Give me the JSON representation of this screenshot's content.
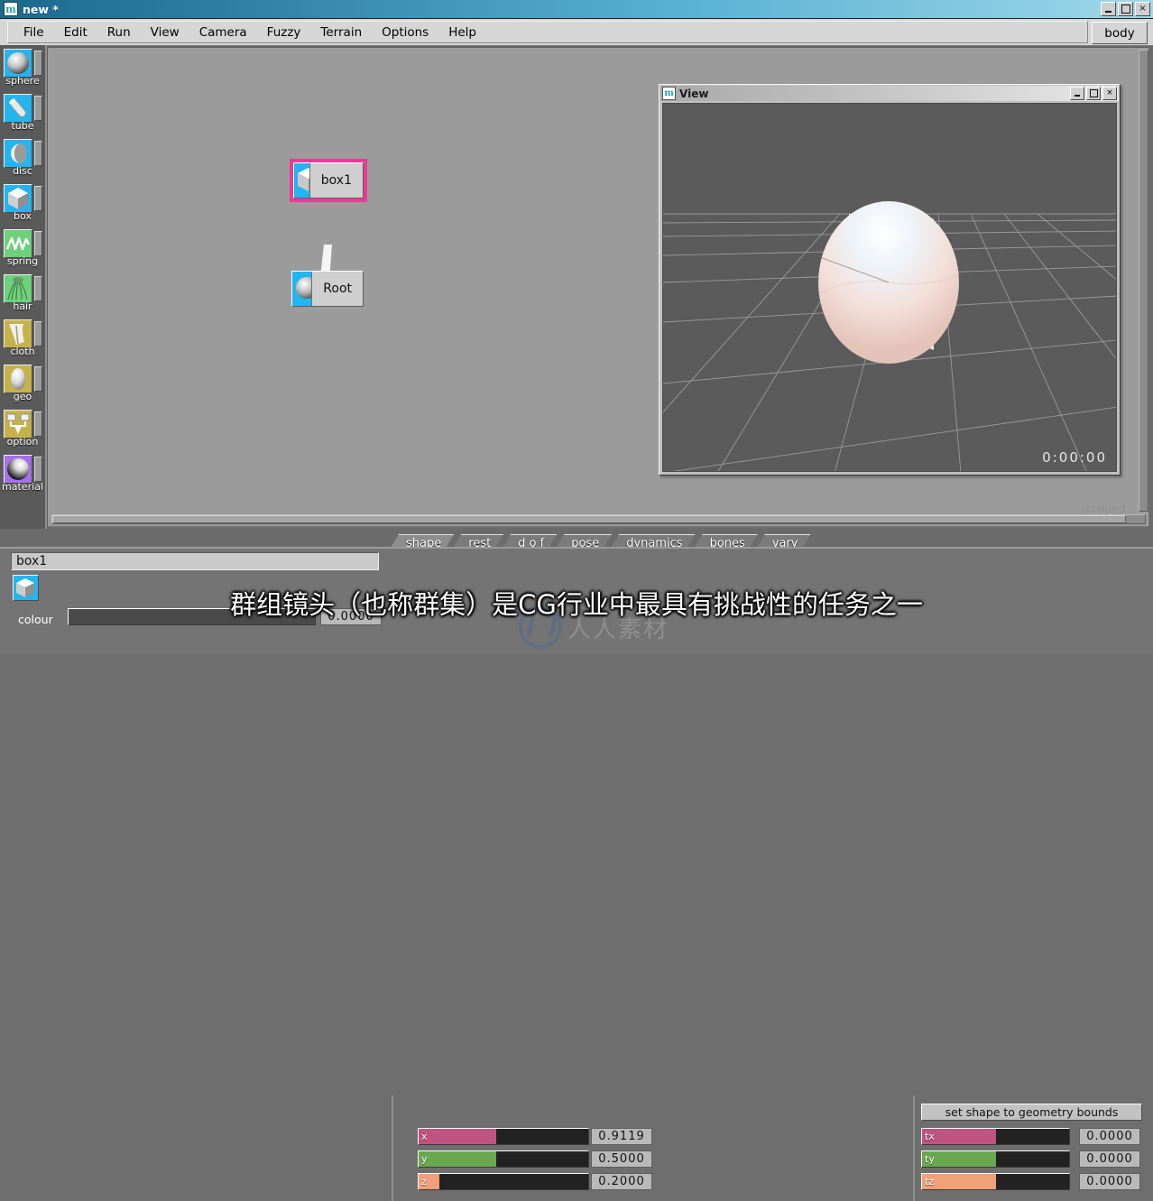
{
  "window": {
    "title": "new *",
    "logo_icon": "app-logo-icon",
    "minimize": "_",
    "maximize": "□",
    "close": "×"
  },
  "menubar": {
    "items": [
      {
        "label": "File"
      },
      {
        "label": "Edit"
      },
      {
        "label": "Run"
      },
      {
        "label": "View"
      },
      {
        "label": "Camera"
      },
      {
        "label": "Fuzzy"
      },
      {
        "label": "Terrain"
      },
      {
        "label": "Options"
      },
      {
        "label": "Help"
      }
    ],
    "mode_button": "body"
  },
  "palette": {
    "tools": [
      {
        "label": "sphere",
        "icon": "sphere-icon",
        "swatch_color": "#22b5ef"
      },
      {
        "label": "tube",
        "icon": "tube-icon",
        "swatch_color": "#22b5ef"
      },
      {
        "label": "disc",
        "icon": "disc-icon",
        "swatch_color": "#22b5ef"
      },
      {
        "label": "box",
        "icon": "box-icon",
        "swatch_color": "#22b5ef"
      },
      {
        "label": "spring",
        "icon": "spring-icon",
        "swatch_color": "#6ed07a"
      },
      {
        "label": "hair",
        "icon": "hair-icon",
        "swatch_color": "#6ed07a"
      },
      {
        "label": "cloth",
        "icon": "cloth-icon",
        "swatch_color": "#c6b24a"
      },
      {
        "label": "geo",
        "icon": "geo-icon",
        "swatch_color": "#c6b24a"
      },
      {
        "label": "option",
        "icon": "option-icon",
        "swatch_color": "#c6b24a"
      },
      {
        "label": "material",
        "icon": "material-icon",
        "swatch_color": "#a571e8"
      }
    ]
  },
  "graph": {
    "nodes": [
      {
        "label": "box1",
        "icon": "box-node-icon",
        "selected": true
      },
      {
        "label": "Root",
        "icon": "sphere-node-icon",
        "selected": false
      }
    ],
    "selection_color": "#f0379a"
  },
  "viewwindow": {
    "title": "View",
    "logo_icon": "app-logo-icon",
    "minimize": "_",
    "maximize": "□",
    "close": "×",
    "timecode": "0:00:00",
    "status": "stopped"
  },
  "tabs": [
    {
      "label": "shape",
      "active": true
    },
    {
      "label": "rest",
      "active": false
    },
    {
      "label": "d o f",
      "active": false
    },
    {
      "label": "pose",
      "active": false
    },
    {
      "label": "dynamics",
      "active": false
    },
    {
      "label": "bones",
      "active": false
    },
    {
      "label": "vary",
      "active": false
    }
  ],
  "params": {
    "object_name": "box1",
    "object_icon": "box-icon",
    "colour_label": "colour",
    "colour_value": "0.0000",
    "bounds_button": "set shape to geometry bounds",
    "shape_sliders": [
      {
        "tag": "x",
        "value": "0.9119",
        "fill": 0.46,
        "fill_color": "#c1537f"
      },
      {
        "tag": "y",
        "value": "0.5000",
        "fill": 0.46,
        "fill_color": "#6aa84f"
      },
      {
        "tag": "z",
        "value": "0.2000",
        "fill": 0.12,
        "fill_color": "#f2a07a"
      }
    ],
    "translate_sliders": [
      {
        "tag": "tx",
        "value": "0.0000",
        "fill": 0.5,
        "fill_color": "#c1537f"
      },
      {
        "tag": "ty",
        "value": "0.0000",
        "fill": 0.5,
        "fill_color": "#6aa84f"
      },
      {
        "tag": "tz",
        "value": "0.0000",
        "fill": 0.5,
        "fill_color": "#f2a07a"
      }
    ]
  },
  "overlay": {
    "subtitle": "群组镜头（也称群集）是CG行业中最具有挑战性的任务之一",
    "watermark_text": "人人素材"
  }
}
